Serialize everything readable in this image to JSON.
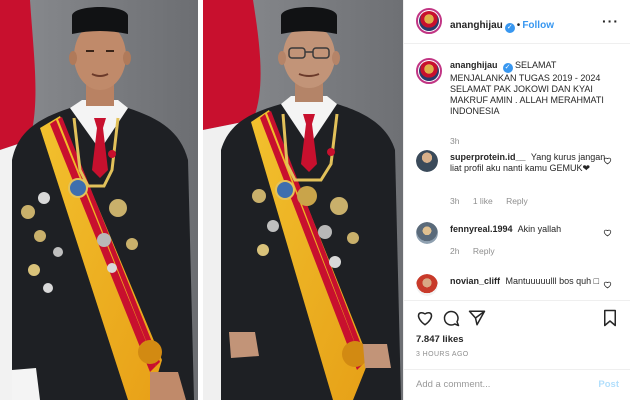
{
  "post": {
    "author": "ananghijau",
    "follow_label": "Follow",
    "caption": "SELAMAT MENJALANKAN TUGAS 2019 - 2024 SELAMAT PAK JOKOWI DAN KYAI MAKRUF AMIN . ALLAH MERAHMATI INDONESIA",
    "caption_age": "3h"
  },
  "comments": [
    {
      "user": "superprotein.id__",
      "text": "Yang kurus jangan liat profil aku nanti kamu GEMUK❤",
      "age": "3h",
      "likes": "1 like",
      "reply": "Reply"
    },
    {
      "user": "fennyreal.1994",
      "text": "Akin yallah",
      "age": "2h",
      "reply": "Reply"
    },
    {
      "user": "novian_cliff",
      "text": "Mantuuuuulll bos quh □"
    }
  ],
  "actions": {
    "likes": "7.847 likes",
    "time": "3 HOURS AGO",
    "add_comment_placeholder": "Add a comment...",
    "post_label": "Post"
  },
  "icons": [
    "verified-icon",
    "more-options-icon",
    "heart-icon",
    "comment-icon",
    "share-icon",
    "bookmark-icon"
  ],
  "colors": {
    "accent": "#3897f0",
    "post_disabled": "#b2dffc",
    "muted": "#8e8e8e"
  }
}
